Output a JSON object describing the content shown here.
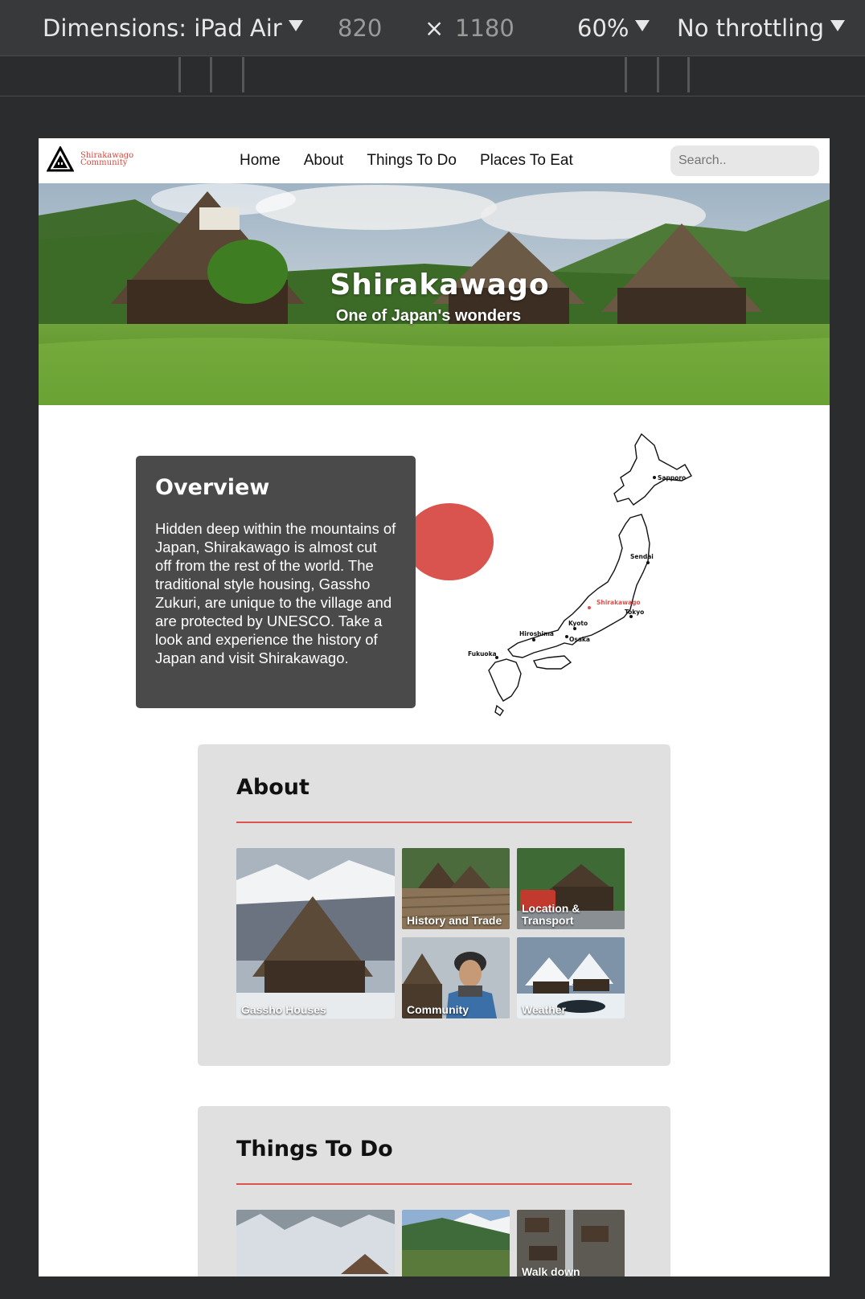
{
  "devtools": {
    "dimensions_label": "Dimensions: iPad Air",
    "width": "820",
    "times": "×",
    "height": "1180",
    "zoom": "60%",
    "throttling": "No throttling"
  },
  "nav": {
    "brand_line1": "Shirakawago",
    "brand_line2": "Community",
    "links": [
      "Home",
      "About",
      "Things To Do",
      "Places To Eat"
    ],
    "search_placeholder": "Search.."
  },
  "hero": {
    "title": "Shirakawago",
    "subtitle": "One of Japan's wonders"
  },
  "overview": {
    "heading": "Overview",
    "body": "Hidden deep within the mountains of Japan, Shirakawago is almost cut off from the rest of the world. The traditional style housing, Gassho Zukuri, are unique to the village and are protected by UNESCO. Take a look and experience the history of Japan and visit Shirakawago."
  },
  "map": {
    "cities": [
      "Sapporo",
      "Sendai",
      "Shirakawago",
      "Tokyo",
      "Kyoto",
      "Osaka",
      "Hiroshima",
      "Fukuoka"
    ]
  },
  "about": {
    "heading": "About",
    "tiles": [
      "Gassho Houses",
      "History and Trade",
      "Location & Transport",
      "Community",
      "Weather"
    ]
  },
  "things_to_do": {
    "heading": "Things To Do",
    "tiles": [
      "",
      "",
      "Walk down"
    ]
  },
  "colors": {
    "accent": "#d9534f",
    "overview_bg": "#4a4a4a",
    "section_bg": "#e0e0e0"
  }
}
